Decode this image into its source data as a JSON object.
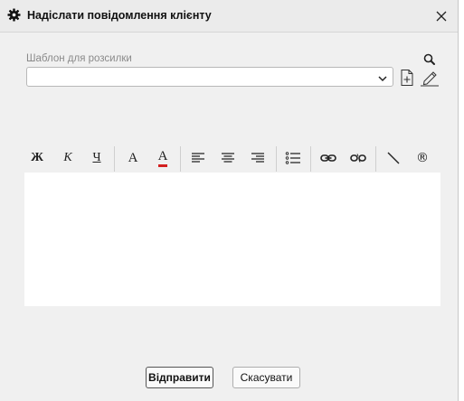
{
  "dialog": {
    "title": "Надіслати повідомлення клієнту",
    "title_icon": "gear-icon",
    "close_icon": "close-icon"
  },
  "template": {
    "label": "Шаблон для розсилки",
    "selected_value": "",
    "icons": {
      "search": "search-icon",
      "add": "add-document-icon",
      "edit": "pencil-icon"
    }
  },
  "toolbar": {
    "bold": "Ж",
    "italic": "К",
    "underline": "Ч",
    "font": "A",
    "font_color": "A",
    "font_color_hex": "#d21f1f",
    "icons": [
      "align-left-icon",
      "align-center-icon",
      "align-right-icon",
      "bullet-list-icon",
      "link-icon",
      "unlink-icon",
      "horizontal-rule-icon",
      "registered-sign-icon"
    ],
    "registered_glyph": "®"
  },
  "editor": {
    "content": ""
  },
  "footer": {
    "send_label": "Відправити",
    "cancel_label": "Скасувати"
  }
}
